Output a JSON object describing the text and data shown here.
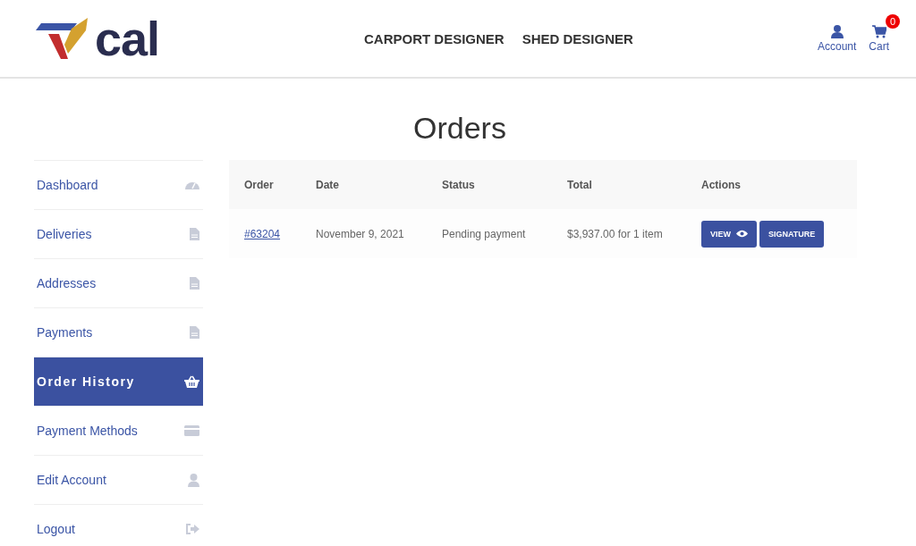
{
  "logo": {
    "text": "cal"
  },
  "nav": [
    "CARPORT DESIGNER",
    "SHED DESIGNER"
  ],
  "account": {
    "label": "Account"
  },
  "cart": {
    "label": "Cart",
    "count": "0"
  },
  "title": "Orders",
  "sidebar": {
    "items": [
      {
        "label": "Dashboard",
        "kind": "dashboard",
        "selected": false
      },
      {
        "label": "Deliveries",
        "kind": "file",
        "selected": false
      },
      {
        "label": "Addresses",
        "kind": "file",
        "selected": false
      },
      {
        "label": "Payments",
        "kind": "file",
        "selected": false
      },
      {
        "label": "Order History",
        "kind": "basket",
        "selected": true
      },
      {
        "label": "Payment Methods",
        "kind": "card",
        "selected": false
      },
      {
        "label": "Edit Account",
        "kind": "user",
        "selected": false
      },
      {
        "label": "Logout",
        "kind": "logout",
        "selected": false
      }
    ]
  },
  "table": {
    "columns": [
      "Order",
      "Date",
      "Status",
      "Total",
      "Actions"
    ],
    "rows": [
      {
        "order": "#63204",
        "date": "November 9, 2021",
        "status": "Pending payment",
        "total": "$3,937.00 for 1 item",
        "actions": [
          {
            "label": "VIEW",
            "kind": "view"
          },
          {
            "label": "SIGNATURE",
            "kind": "plain"
          }
        ]
      }
    ]
  }
}
